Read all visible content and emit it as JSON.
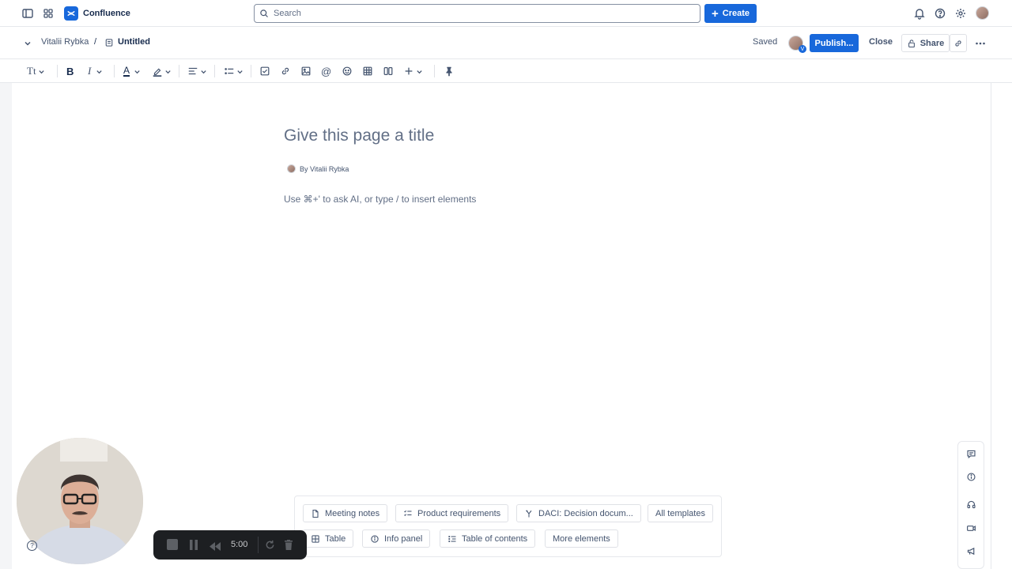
{
  "app": {
    "name": "Confluence",
    "accent": "#1868db"
  },
  "topbar": {
    "search_placeholder": "Search",
    "create_label": "Create"
  },
  "header": {
    "breadcrumb_user": "Vitalii Rybka",
    "breadcrumb_sep": "/",
    "page_name": "Untitled",
    "saved_status": "Saved",
    "collaborator_badge": "V",
    "publish_label": "Publish...",
    "close_label": "Close",
    "share_label": "Share"
  },
  "toolbar": {
    "text_style_icon": "text-style-icon",
    "items": [
      "bold-icon",
      "italic-icon",
      "text-color-icon",
      "highlight-icon",
      "align-icon",
      "list-icon",
      "checkbox-icon",
      "link-icon",
      "image-icon",
      "mention-icon",
      "emoji-icon",
      "table-icon",
      "layout-icon",
      "plus-icon",
      "pin-icon"
    ]
  },
  "editor": {
    "title_placeholder": "Give this page a title",
    "byline": "By Vitalii Rybka",
    "body_placeholder": "Use ⌘+' to ask AI, or type / to insert elements"
  },
  "templates": {
    "row1": [
      {
        "label": "Meeting notes",
        "icon": "file-icon"
      },
      {
        "label": "Product requirements",
        "icon": "checklist-icon"
      },
      {
        "label": "DACI: Decision docum...",
        "icon": "decision-icon"
      },
      {
        "label": "All templates",
        "icon": ""
      }
    ],
    "row2": [
      {
        "label": "Table",
        "icon": "table-icon"
      },
      {
        "label": "Info panel",
        "icon": "info-icon"
      },
      {
        "label": "Table of contents",
        "icon": "toc-icon"
      },
      {
        "label": "More elements",
        "icon": ""
      }
    ]
  },
  "right_rail": [
    "comment-icon",
    "info-icon",
    "headset-icon",
    "video-icon",
    "megaphone-icon"
  ],
  "recorder": {
    "time": "5:00"
  }
}
